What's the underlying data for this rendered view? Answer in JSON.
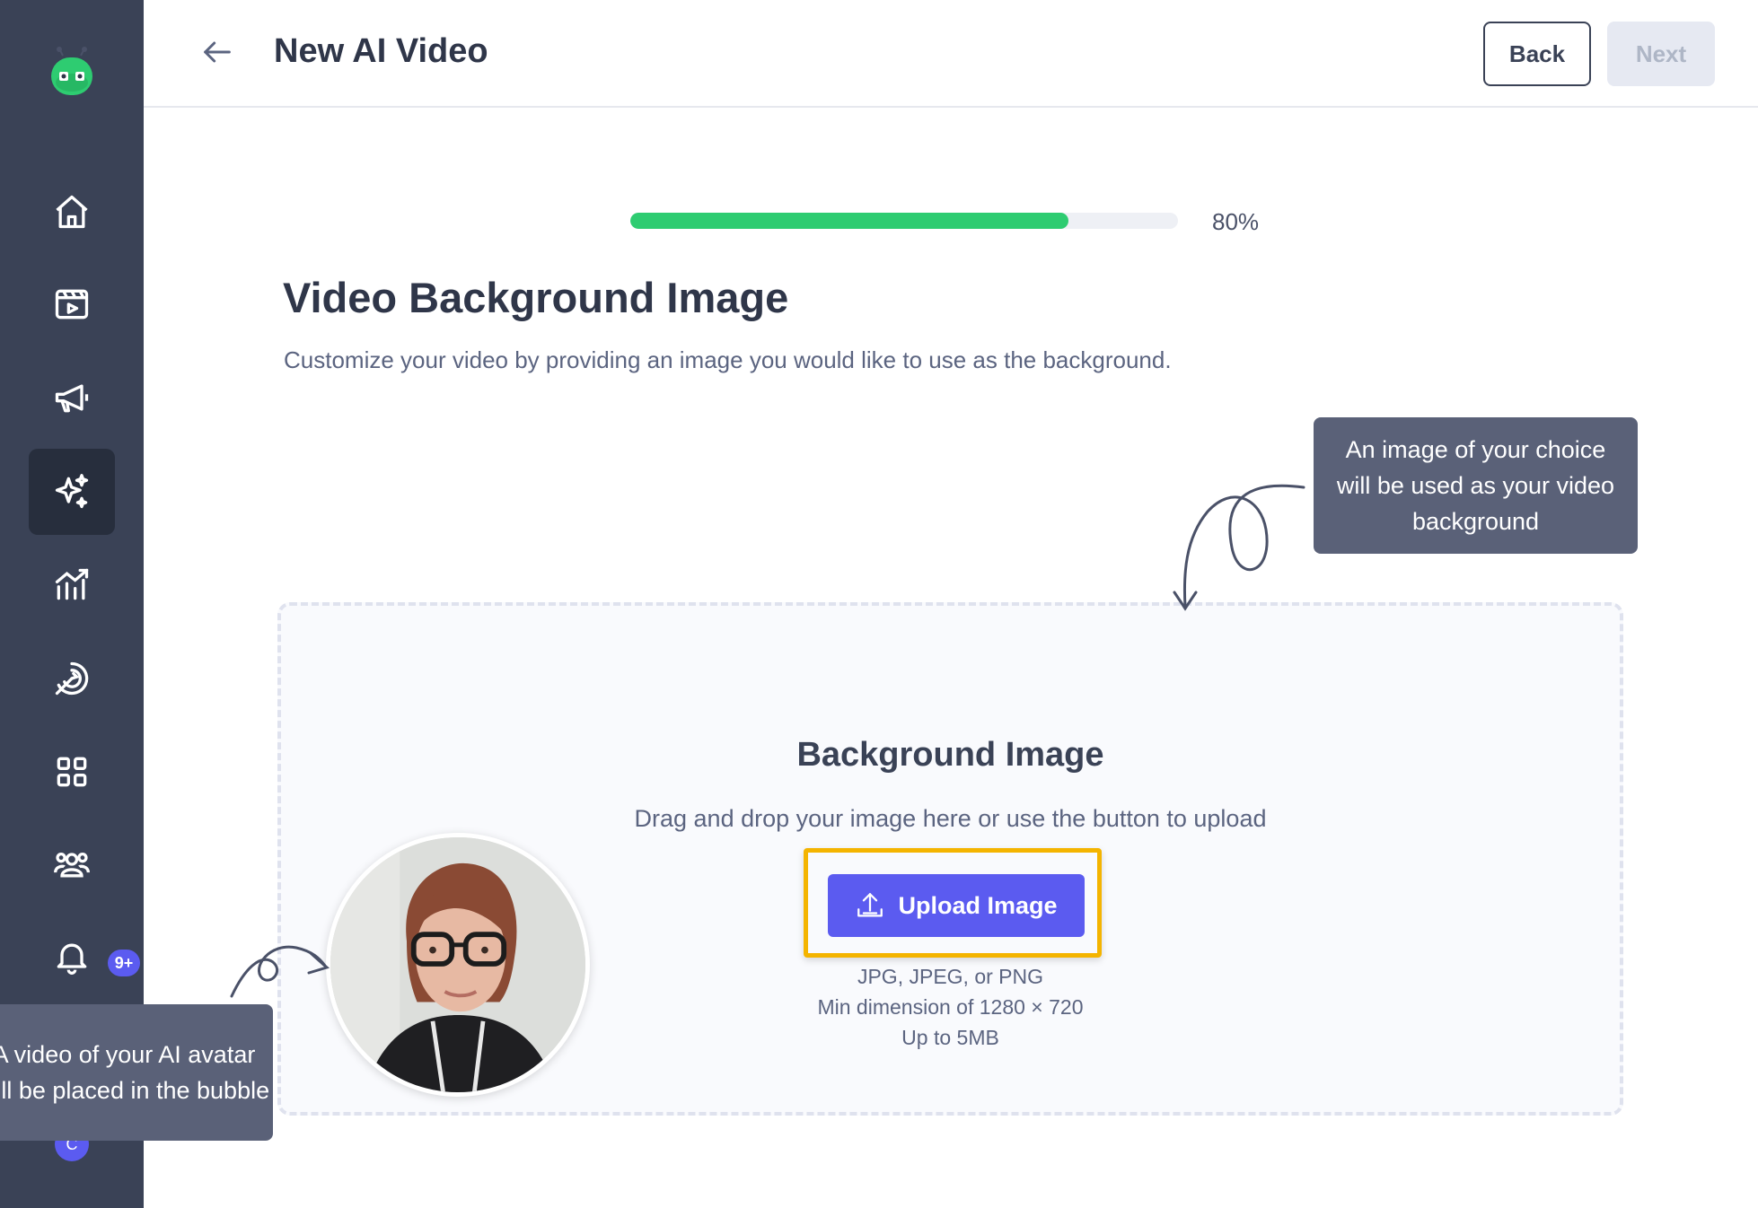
{
  "header": {
    "title": "New AI Video",
    "back_label": "Back",
    "next_label": "Next"
  },
  "sidebar": {
    "items": [
      {
        "icon": "home-icon"
      },
      {
        "icon": "video-clapper-icon"
      },
      {
        "icon": "megaphone-icon"
      },
      {
        "icon": "sparkles-icon",
        "active": true
      },
      {
        "icon": "analytics-icon"
      },
      {
        "icon": "target-icon"
      },
      {
        "icon": "apps-grid-icon"
      },
      {
        "icon": "team-icon"
      },
      {
        "icon": "bell-icon",
        "badge": "9+"
      }
    ],
    "user_initial": "C"
  },
  "progress": {
    "value": 0.8,
    "label": "80%",
    "fill_color": "#2ecc71"
  },
  "section": {
    "title": "Video Background Image",
    "description": "Customize your video by providing an image you would like to use as the background."
  },
  "tooltips": {
    "background_hint": "An image of your choice will be used as your video background",
    "avatar_hint": "A video of your AI avatar will be placed in the bubble"
  },
  "dropzone": {
    "title": "Background Image",
    "description": "Drag and drop your image here or use the button to upload",
    "upload_label": "Upload Image",
    "requirements": [
      "JPG, JPEG, or PNG",
      "Min dimension of 1280 × 720",
      "Up to 5MB"
    ]
  },
  "colors": {
    "sidebar": "#3a4256",
    "accent": "#5b5bf0",
    "highlight": "#f4b400",
    "tooltip": "#5a6178"
  }
}
